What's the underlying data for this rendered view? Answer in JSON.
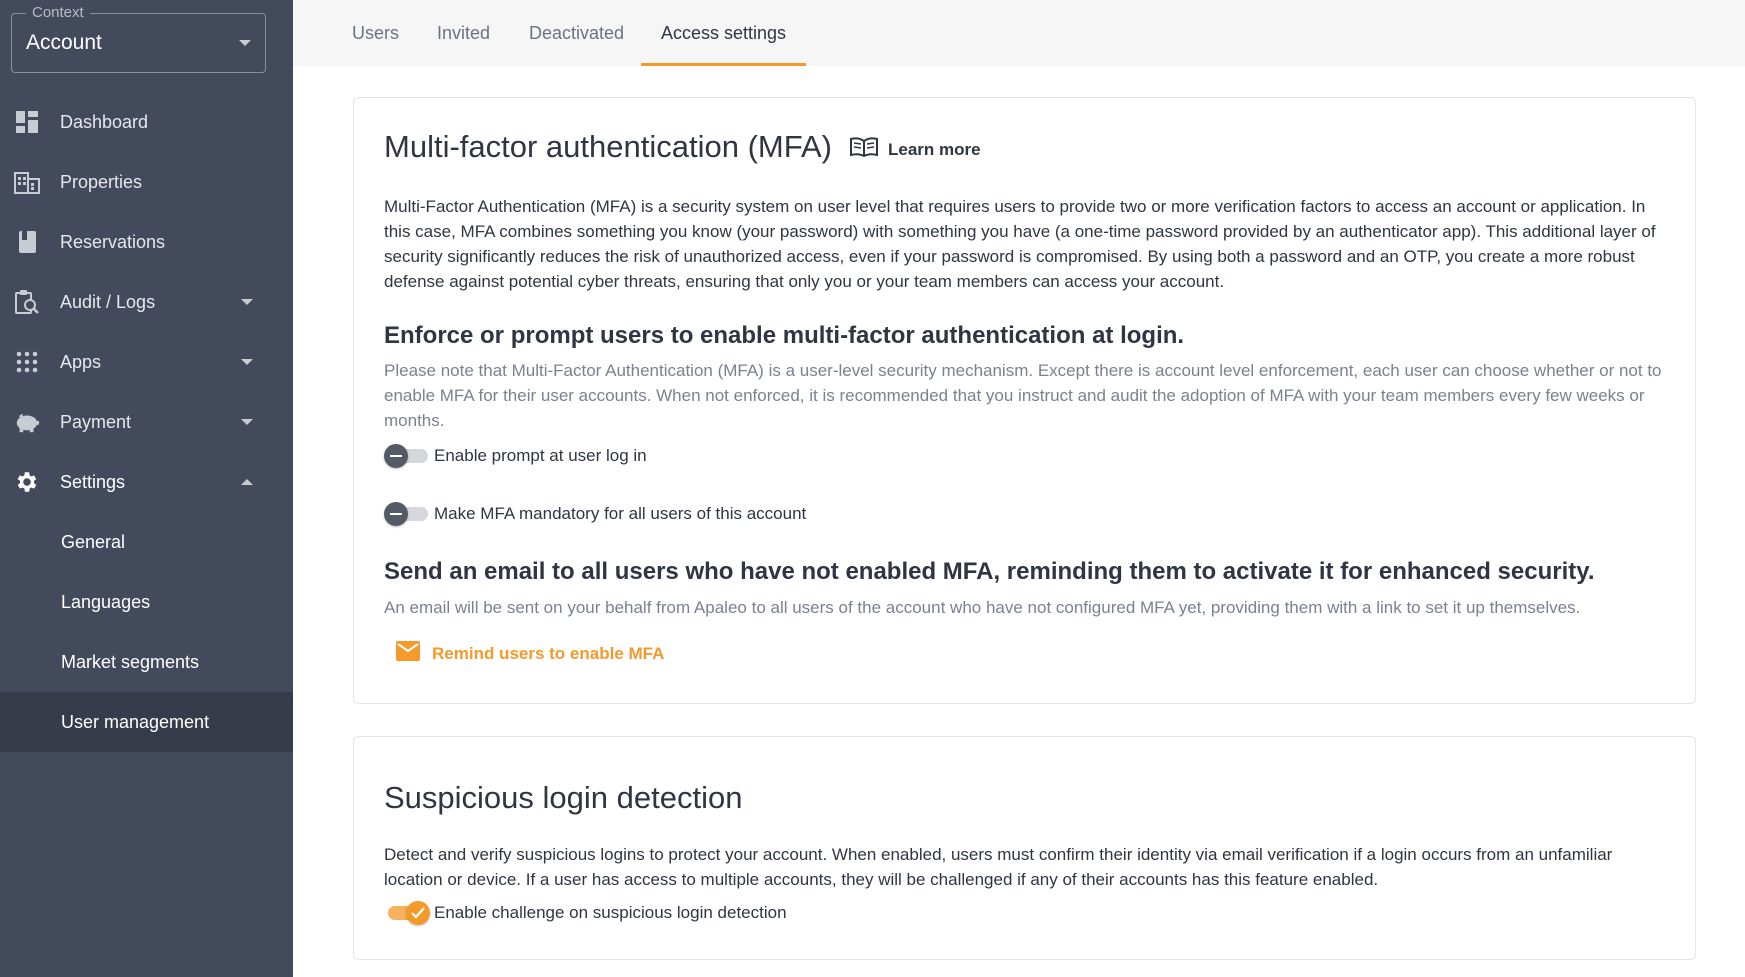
{
  "context": {
    "legend": "Context",
    "value": "Account"
  },
  "sidebar": {
    "items": [
      {
        "label": "Dashboard",
        "icon": "dashboard-icon"
      },
      {
        "label": "Properties",
        "icon": "building-icon"
      },
      {
        "label": "Reservations",
        "icon": "book-icon"
      },
      {
        "label": "Audit / Logs",
        "icon": "audit-icon"
      },
      {
        "label": "Apps",
        "icon": "apps-grid-icon"
      },
      {
        "label": "Payment",
        "icon": "piggy-bank-icon"
      },
      {
        "label": "Settings",
        "icon": "gear-icon"
      }
    ],
    "sub_items": [
      {
        "label": "General"
      },
      {
        "label": "Languages"
      },
      {
        "label": "Market segments"
      },
      {
        "label": "User management"
      }
    ]
  },
  "tabs": [
    {
      "label": "Users"
    },
    {
      "label": "Invited"
    },
    {
      "label": "Deactivated"
    },
    {
      "label": "Access settings"
    }
  ],
  "mfa": {
    "title": "Multi-factor authentication (MFA)",
    "learn_more": "Learn more",
    "description": "Multi-Factor Authentication (MFA) is a security system on user level that requires users to provide two or more verification factors to access an account or application. In this case, MFA combines something you know (your password) with something you have (a one-time password provided by an authenticator app). This additional layer of security significantly reduces the risk of unauthorized access, even if your password is compromised. By using both a password and an OTP, you create a more robust defense against potential cyber threats, ensuring that only you or your team members can access your account.",
    "enforce_heading": "Enforce or prompt users to enable multi-factor authentication at login.",
    "enforce_note": "Please note that Multi-Factor Authentication (MFA) is a user-level security mechanism. Except there is account level enforcement, each user can choose whether or not to enable MFA for their user accounts. When not enforced, it is recommended that you instruct and audit the adoption of MFA with your team members every few weeks or months.",
    "toggle_prompt": "Enable prompt at user log in",
    "toggle_mandatory": "Make MFA mandatory for all users of this account",
    "email_heading": "Send an email to all users who have not enabled MFA, reminding them to activate it for enhanced security.",
    "email_note": "An email will be sent on your behalf from Apaleo to all users of the account who have not configured MFA yet, providing them with a link to set it up themselves.",
    "remind_button": "Remind users to enable MFA"
  },
  "suspicious": {
    "title": "Suspicious login detection",
    "description": "Detect and verify suspicious logins to protect your account. When enabled, users must confirm their identity via email verification if a login occurs from an unfamiliar location or device. If a user has access to multiple accounts, they will be challenged if any of their accounts has this feature enabled.",
    "toggle_challenge": "Enable challenge on suspicious login detection"
  },
  "colors": {
    "sidebar": "#434a5b",
    "accent": "#f39a2b",
    "active_item": "#363c4a"
  }
}
